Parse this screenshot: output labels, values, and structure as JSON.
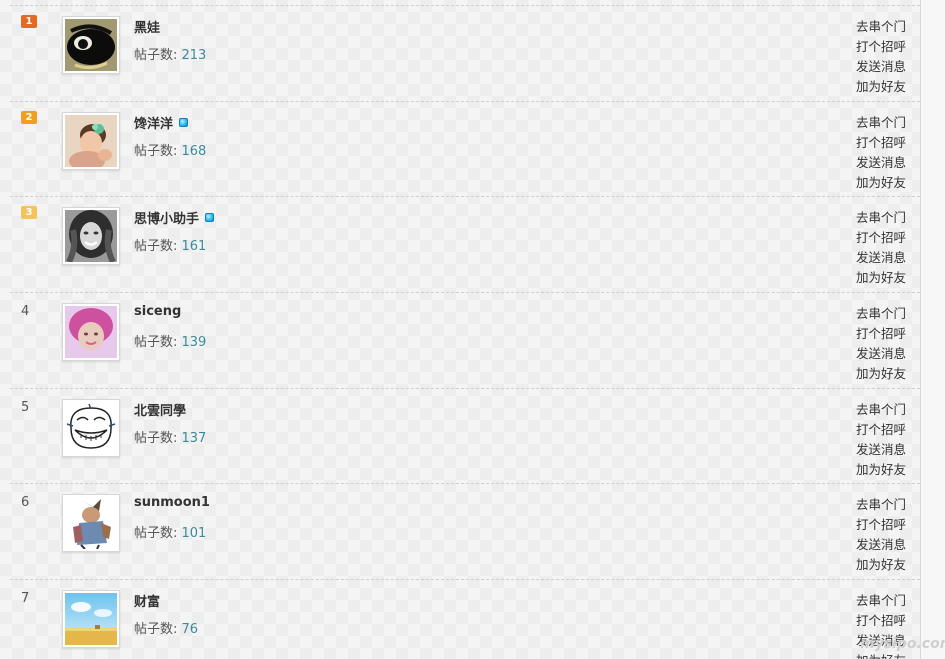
{
  "post_label": "帖子数: ",
  "actions": [
    "去串个门",
    "打个招呼",
    "发送消息",
    "加为好友"
  ],
  "watermark": "mysipo.com",
  "badge_colors": [
    "#e46a22",
    "#efa021",
    "#f2c55c"
  ],
  "link_color": "#3a8a9a",
  "users": [
    {
      "rank": "1",
      "name": "黑娃",
      "posts": "213",
      "online": false,
      "avatar": "black-eye-cartoon"
    },
    {
      "rank": "2",
      "name": "馋洋洋",
      "posts": "168",
      "online": true,
      "avatar": "child-photo"
    },
    {
      "rank": "3",
      "name": "思博小助手",
      "posts": "161",
      "online": true,
      "avatar": "woman-bw-photo"
    },
    {
      "rank": "4",
      "name": "siceng",
      "posts": "139",
      "online": false,
      "avatar": "pink-hair-girl"
    },
    {
      "rank": "5",
      "name": "北雲同學",
      "posts": "137",
      "online": false,
      "avatar": "trollface-sketch"
    },
    {
      "rank": "6",
      "name": "sunmoon1",
      "posts": "101",
      "online": false,
      "avatar": "warrior-illustration"
    },
    {
      "rank": "7",
      "name": "财富",
      "posts": "76",
      "online": false,
      "avatar": "sky-field-landscape"
    }
  ]
}
